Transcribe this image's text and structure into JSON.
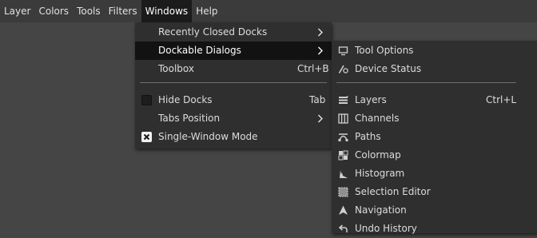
{
  "menubar": {
    "items": [
      "Layer",
      "Colors",
      "Tools",
      "Filters",
      "Windows",
      "Help"
    ],
    "active": "Windows"
  },
  "windows_menu": {
    "items": [
      {
        "label": "Recently Closed Docks",
        "submenu": true
      },
      {
        "label": "Dockable Dialogs",
        "submenu": true,
        "highlighted": true
      },
      {
        "label": "Toolbox",
        "shortcut": "Ctrl+B"
      },
      {
        "label": "Hide Docks",
        "shortcut": "Tab",
        "checked": false
      },
      {
        "label": "Tabs Position",
        "submenu": true
      },
      {
        "label": "Single-Window Mode",
        "checked": true
      }
    ]
  },
  "dockable_dialogs_menu": {
    "items": [
      {
        "label": "Tool Options",
        "icon": "tool-options-icon"
      },
      {
        "label": "Device Status",
        "icon": "device-status-icon"
      },
      {
        "label": "Layers",
        "icon": "layers-icon",
        "shortcut": "Ctrl+L"
      },
      {
        "label": "Channels",
        "icon": "channels-icon"
      },
      {
        "label": "Paths",
        "icon": "paths-icon"
      },
      {
        "label": "Colormap",
        "icon": "colormap-icon"
      },
      {
        "label": "Histogram",
        "icon": "histogram-icon"
      },
      {
        "label": "Selection Editor",
        "icon": "selection-editor-icon"
      },
      {
        "label": "Navigation",
        "icon": "navigation-icon"
      },
      {
        "label": "Undo History",
        "icon": "undo-history-icon"
      }
    ]
  },
  "colors": {
    "canvas": "#454545",
    "menubar": "#3b3b3b",
    "menu": "#2f2f2f",
    "highlight": "#121212",
    "text": "#dcdcdc"
  }
}
